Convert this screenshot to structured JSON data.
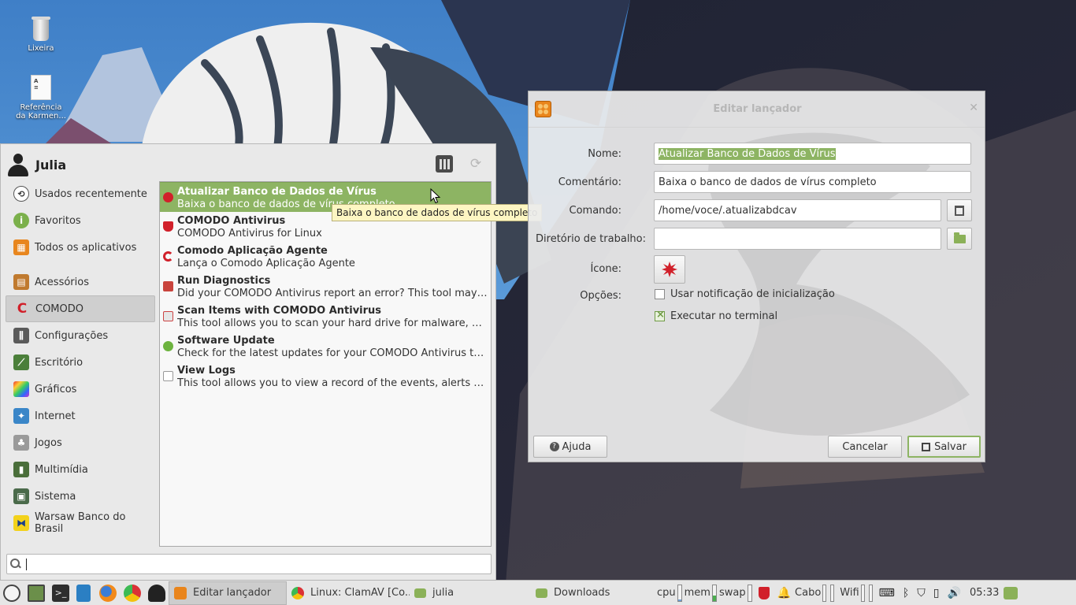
{
  "desktop": {
    "icons": [
      {
        "label": "Lixeira"
      },
      {
        "label": "Referência da Karmen..."
      }
    ]
  },
  "menu": {
    "user_name": "Julia",
    "categories": [
      {
        "label": "Usados recentemente",
        "icon": "clock-icon"
      },
      {
        "label": "Favoritos",
        "icon": "info-icon"
      },
      {
        "label": "Todos os aplicativos",
        "icon": "all-apps-icon"
      },
      {
        "label": "Acessórios",
        "icon": "accessories-icon"
      },
      {
        "label": "COMODO",
        "icon": "comodo-icon",
        "active": true
      },
      {
        "label": "Configurações",
        "icon": "settings-icon"
      },
      {
        "label": "Escritório",
        "icon": "office-icon"
      },
      {
        "label": "Gráficos",
        "icon": "graphics-icon"
      },
      {
        "label": "Internet",
        "icon": "internet-icon"
      },
      {
        "label": "Jogos",
        "icon": "games-icon"
      },
      {
        "label": "Multimídia",
        "icon": "multimedia-icon"
      },
      {
        "label": "Sistema",
        "icon": "system-icon"
      },
      {
        "label": "Warsaw Banco do Brasil",
        "icon": "warsaw-icon"
      }
    ],
    "apps": [
      {
        "title": "Atualizar Banco de Dados de Vírus",
        "desc": "Baixa o banco de dados de vírus completo",
        "icon": "virus-update-icon",
        "selected": true
      },
      {
        "title": "COMODO Antivirus",
        "desc": "COMODO Antivirus for Linux",
        "icon": "comodo-shield-icon"
      },
      {
        "title": "Comodo Aplicação Agente",
        "desc": "Lança o Comodo Aplicação Agente",
        "icon": "comodo-agent-icon"
      },
      {
        "title": "Run Diagnostics",
        "desc": "Did your COMODO Antivirus report an error? This tool may help you fix it.",
        "icon": "diagnostics-icon"
      },
      {
        "title": "Scan Items with COMODO Antivirus",
        "desc": "This tool allows you to scan your hard drive for malware, viruses and other threats.",
        "icon": "scan-icon"
      },
      {
        "title": "Software Update",
        "desc": "Check for the latest updates for your COMODO Antivirus to make sure you're protected.",
        "icon": "software-update-icon"
      },
      {
        "title": "View Logs",
        "desc": "This tool allows you to view a record of the events, alerts and actions.",
        "icon": "logs-icon"
      }
    ],
    "tooltip": "Baixa o banco de dados de vírus completo",
    "search": {
      "value": ""
    }
  },
  "dialog": {
    "title": "Editar lançador",
    "fields": {
      "name_label": "Nome:",
      "name_value": "Atualizar Banco de Dados de Vírus",
      "comment_label": "Comentário:",
      "comment_value": "Baixa o banco de dados de vírus completo",
      "command_label": "Comando:",
      "command_value": "/home/voce/.atualizabdcav",
      "workdir_label": "Diretório de trabalho:",
      "workdir_value": "",
      "icon_label": "Ícone:",
      "options_label": "Opções:"
    },
    "options": [
      {
        "label": "Usar notificação de inicialização",
        "checked": false
      },
      {
        "label": "Executar no terminal",
        "checked": true
      }
    ],
    "buttons": {
      "help": "Ajuda",
      "cancel": "Cancelar",
      "save": "Salvar"
    }
  },
  "taskbar": {
    "tasks": [
      {
        "label": "Editar lançador",
        "icon": "launcher-editor-icon",
        "active": true
      },
      {
        "label": "Linux: ClamAV [Co...",
        "icon": "chrome-icon"
      },
      {
        "label": "julia",
        "icon": "folder-icon"
      },
      {
        "label": "Downloads",
        "icon": "folder-icon"
      }
    ],
    "monitors": {
      "cpu_label": "cpu",
      "cpu_level": 0.08,
      "mem_label": "mem",
      "mem_level": 0.35,
      "swap_label": "swap",
      "swap_level": 0.0
    },
    "network": {
      "wired_label": "Cabo",
      "wifi_label": "Wifi"
    },
    "clock": "05:33"
  },
  "colors": {
    "mint_green": "#8db463",
    "comodo_red": "#d1202a"
  }
}
